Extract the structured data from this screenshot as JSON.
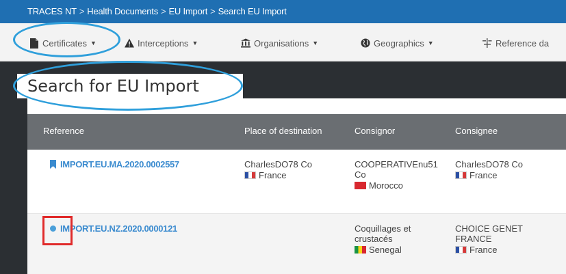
{
  "breadcrumb": {
    "items": [
      "TRACES NT",
      "Health Documents",
      "EU Import",
      "Search EU Import"
    ],
    "separator": ">"
  },
  "menu": {
    "items": [
      {
        "label": "Certificates",
        "icon": "document-icon"
      },
      {
        "label": "Interceptions",
        "icon": "warning-icon"
      },
      {
        "label": "Organisations",
        "icon": "institution-icon"
      },
      {
        "label": "Geographics",
        "icon": "globe-icon"
      },
      {
        "label": "Reference da",
        "icon": "reference-data-icon"
      }
    ]
  },
  "page": {
    "title": "Search for EU Import"
  },
  "table": {
    "headers": [
      "Reference",
      "Place of destination",
      "Consignor",
      "Consignee"
    ],
    "rows": [
      {
        "reference": "IMPORT.EU.MA.2020.0002557",
        "status_icon": "bookmark-icon",
        "destination": {
          "name": "CharlesDO78 Co",
          "country": "France"
        },
        "consignor": {
          "name_line1": "COOPERATIVEnu51",
          "name_line2": "Co",
          "country": "Morocco"
        },
        "consignee": {
          "name": "CharlesDO78 Co",
          "country": "France"
        }
      },
      {
        "reference": "IMPORT.EU.NZ.2020.0000121",
        "status_icon": "dot-icon",
        "consignor": {
          "name_line1": "Coquillages et",
          "name_line2": "crustacés",
          "country": "Senegal"
        },
        "consignee": {
          "name_line1": "CHOICE GENET",
          "name_line2": "FRANCE",
          "country": "France"
        }
      }
    ]
  },
  "colors": {
    "breadcrumb_bar": "#1f6fb2",
    "dark_band": "#2b2f33",
    "table_header": "#6a6e72",
    "link": "#3b8bcf",
    "annotation_ellipse": "#2f9fdb",
    "annotation_box": "#e02a2a"
  }
}
